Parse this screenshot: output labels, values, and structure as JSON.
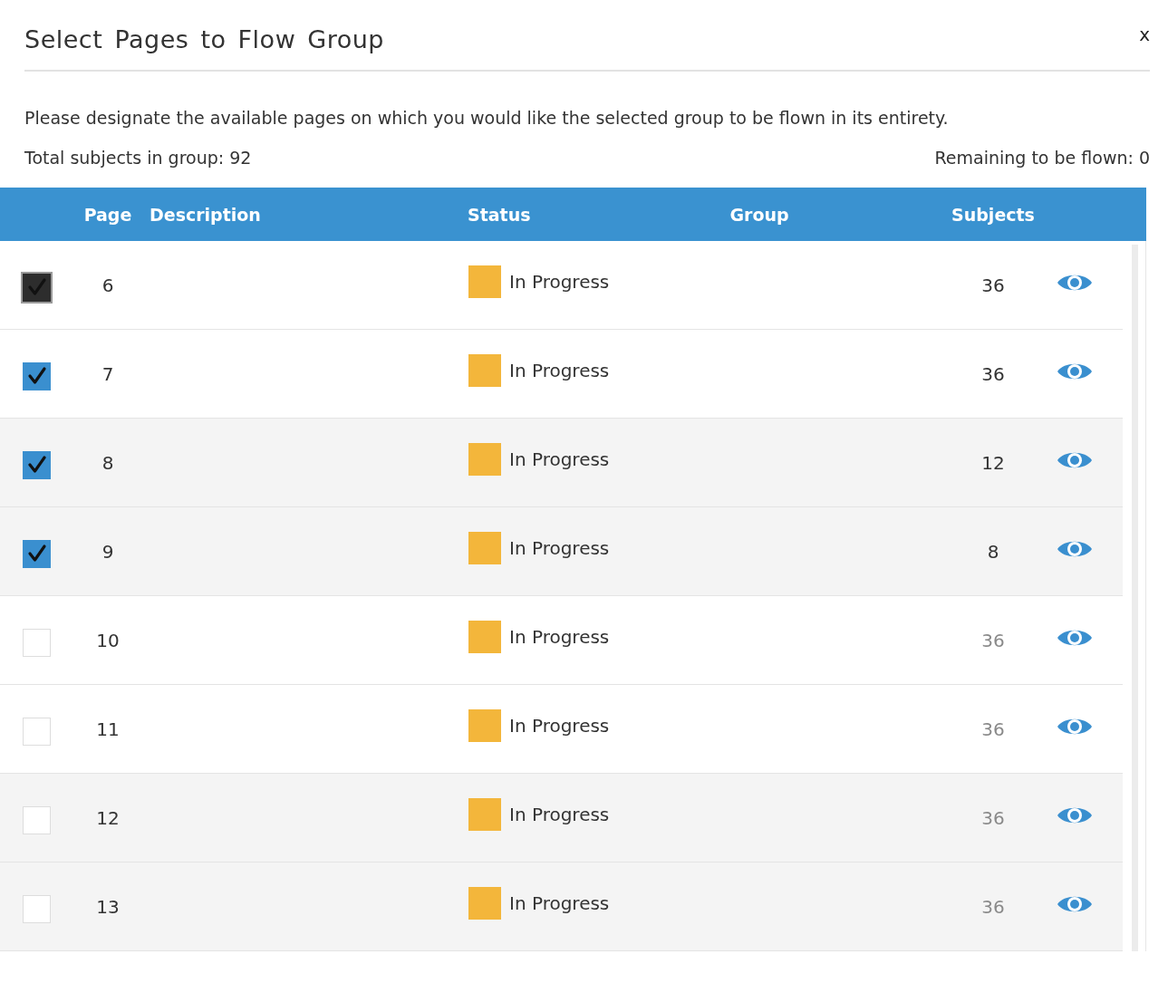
{
  "dialog": {
    "title": "Select Pages to Flow Group",
    "close": "x",
    "instructions": "Please designate the available pages on which you would like the selected group to be flown in its entirety.",
    "total": "Total subjects in group: 92",
    "remaining": "Remaining to be flown: 0"
  },
  "table": {
    "columns": [
      "Page",
      "Description",
      "Status",
      "Group",
      "Subjects"
    ],
    "rows": [
      {
        "page": "6",
        "status": "In Progress",
        "subjects": "36",
        "checked": true,
        "selected": true
      },
      {
        "page": "7",
        "status": "In Progress",
        "subjects": "36",
        "checked": true,
        "selected": false
      },
      {
        "page": "8",
        "status": "In Progress",
        "subjects": "12",
        "checked": true,
        "selected": false
      },
      {
        "page": "9",
        "status": "In Progress",
        "subjects": "8",
        "checked": true,
        "selected": false
      },
      {
        "page": "10",
        "status": "In Progress",
        "subjects": "36",
        "checked": false,
        "selected": false
      },
      {
        "page": "11",
        "status": "In Progress",
        "subjects": "36",
        "checked": false,
        "selected": false
      },
      {
        "page": "12",
        "status": "In Progress",
        "subjects": "36",
        "checked": false,
        "selected": false
      },
      {
        "page": "13",
        "status": "In Progress",
        "subjects": "36",
        "checked": false,
        "selected": false
      }
    ]
  }
}
